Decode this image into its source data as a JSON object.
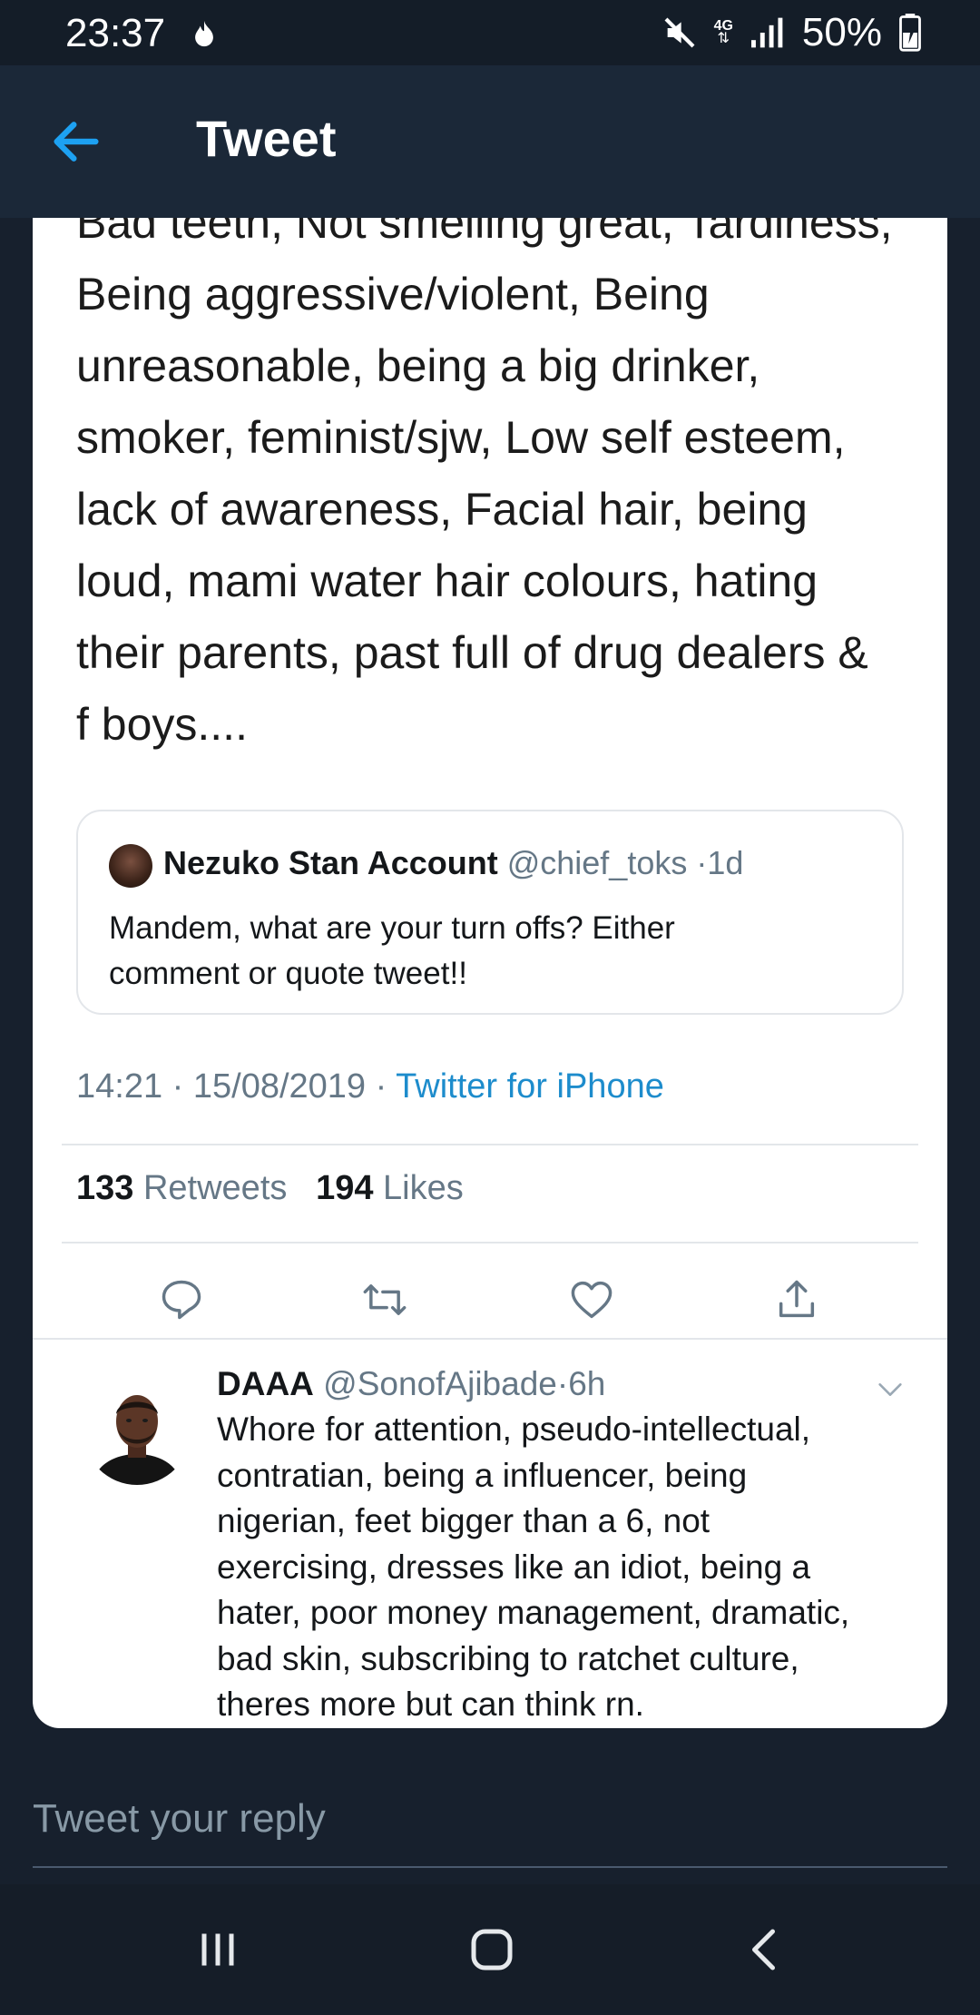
{
  "status_bar": {
    "time": "23:37",
    "network": "4G",
    "battery": "50%"
  },
  "header": {
    "title": "Tweet"
  },
  "tweet": {
    "body": "Bad teeth, Not smelling great, Tardiness,\nBeing aggressive/violent, Being\nunreasonable, being a big drinker,\nsmoker, feminist/sjw, Low self esteem,\nlack of awareness, Facial hair, being\nloud, mami water hair colours, hating\ntheir parents, past full of drug dealers &\nf boys....",
    "quote": {
      "name": "Nezuko Stan Account",
      "handle": "@chief_toks",
      "time": "1d",
      "text": "Mandem, what are your turn offs? Either\ncomment or quote tweet!!"
    },
    "time": "14:21",
    "date": "15/08/2019",
    "source": "Twitter for iPhone",
    "retweets_count": "133",
    "retweets_label": "Retweets",
    "likes_count": "194",
    "likes_label": "Likes"
  },
  "reply": {
    "name": "DAAA",
    "handle": "@SonofAjibade",
    "time": "6h",
    "text": "Whore for attention, pseudo-intellectual,\ncontratian, being a influencer, being\nnigerian, feet bigger than a 6, not\nexercising, dresses like an idiot, being a\nhater, poor money management, dramatic,\nbad skin, subscribing to ratchet culture,\ntheres more but can think rn."
  },
  "reply_box": {
    "placeholder": "Tweet your reply"
  },
  "icons": {
    "back": "arrow-left-icon",
    "reply": "comment-bubble-icon",
    "retweet": "retweet-icon",
    "like": "heart-icon",
    "share": "share-icon",
    "more": "chevron-down-icon"
  },
  "colors": {
    "accent": "#1da1f2",
    "link": "#1d8ccc",
    "secondary_text": "#657786",
    "background": "#17202d"
  }
}
